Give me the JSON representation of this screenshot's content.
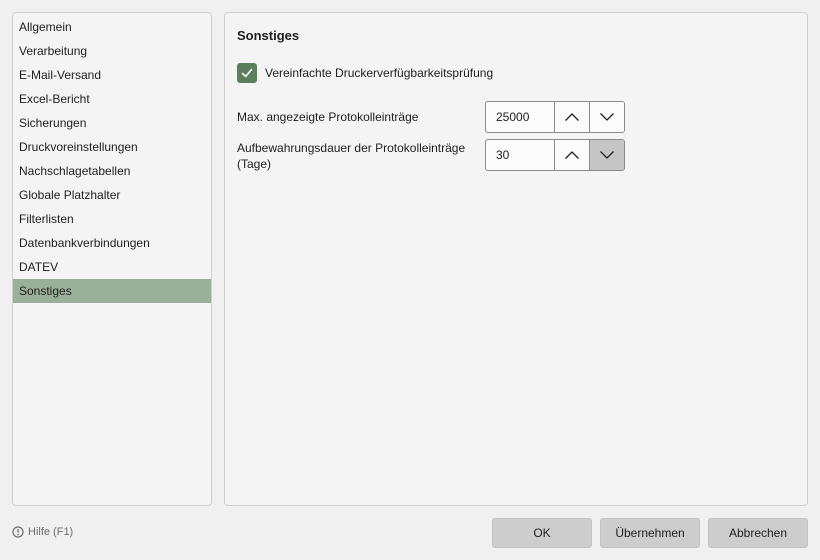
{
  "sidebar": {
    "items": [
      {
        "label": "Allgemein"
      },
      {
        "label": "Verarbeitung"
      },
      {
        "label": "E-Mail-Versand"
      },
      {
        "label": "Excel-Bericht"
      },
      {
        "label": "Sicherungen"
      },
      {
        "label": "Druckvoreinstellungen"
      },
      {
        "label": "Nachschlagetabellen"
      },
      {
        "label": "Globale Platzhalter"
      },
      {
        "label": "Filterlisten"
      },
      {
        "label": "Datenbankverbindungen"
      },
      {
        "label": "DATEV"
      },
      {
        "label": "Sonstiges"
      }
    ],
    "active_index": 11
  },
  "content": {
    "title": "Sonstiges",
    "printer_check": {
      "label": "Vereinfachte Druckerverfügbarkeitsprüfung",
      "checked": true
    },
    "max_entries": {
      "label": "Max. angezeigte Protokolleinträge",
      "value": "25000"
    },
    "retention": {
      "label_line1": "Aufbewahrungsdauer der Protokolleinträge",
      "label_line2": "(Tage)",
      "value": "30"
    }
  },
  "footer": {
    "help": "Hilfe (F1)",
    "ok": "OK",
    "apply": "Übernehmen",
    "cancel": "Abbrechen"
  },
  "icons": {
    "check": "check-icon",
    "up": "chevron-up-icon",
    "down": "chevron-down-icon",
    "help": "info-circle-icon"
  },
  "colors": {
    "accent": "#5b7f5b",
    "selection": "#9bb09b"
  }
}
